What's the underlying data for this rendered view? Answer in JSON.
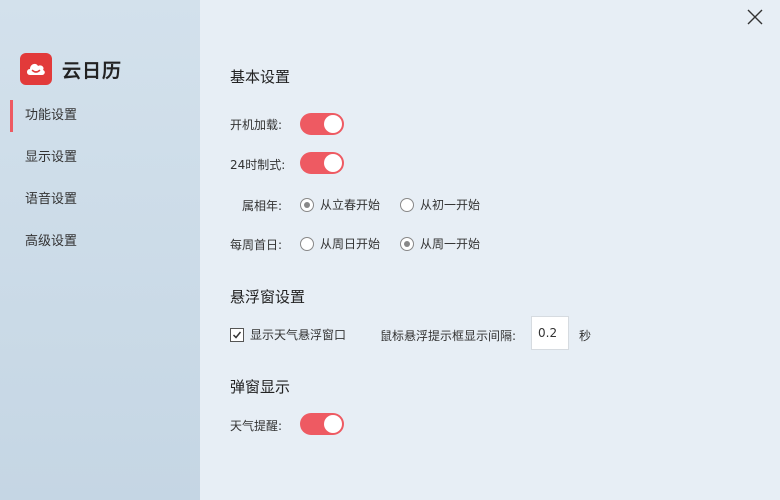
{
  "app": {
    "name": "云日历"
  },
  "sidebar": {
    "items": [
      {
        "label": "功能设置",
        "active": true
      },
      {
        "label": "显示设置",
        "active": false
      },
      {
        "label": "语音设置",
        "active": false
      },
      {
        "label": "高级设置",
        "active": false
      }
    ]
  },
  "basic": {
    "title": "基本设置",
    "autostart": {
      "label": "开机加载:",
      "on": true
    },
    "clock24": {
      "label": "24时制式:",
      "on": true
    },
    "zodiac": {
      "label": "属相年:",
      "options": [
        "从立春开始",
        "从初一开始"
      ],
      "selected": "从立春开始"
    },
    "week_start": {
      "label": "每周首日:",
      "options": [
        "从周日开始",
        "从周一开始"
      ],
      "selected": "从周一开始"
    }
  },
  "float": {
    "title": "悬浮窗设置",
    "show_weather": {
      "label": "显示天气悬浮窗口",
      "checked": true
    },
    "interval_label": "鼠标悬浮提示框显示间隔:",
    "interval_value": "0.2",
    "unit": "秒"
  },
  "popup": {
    "title": "弹窗显示",
    "weather_alert": {
      "label": "天气提醒:",
      "on": true
    }
  },
  "colors": {
    "accent": "#ee5a62",
    "logo": "#e23a3a"
  }
}
